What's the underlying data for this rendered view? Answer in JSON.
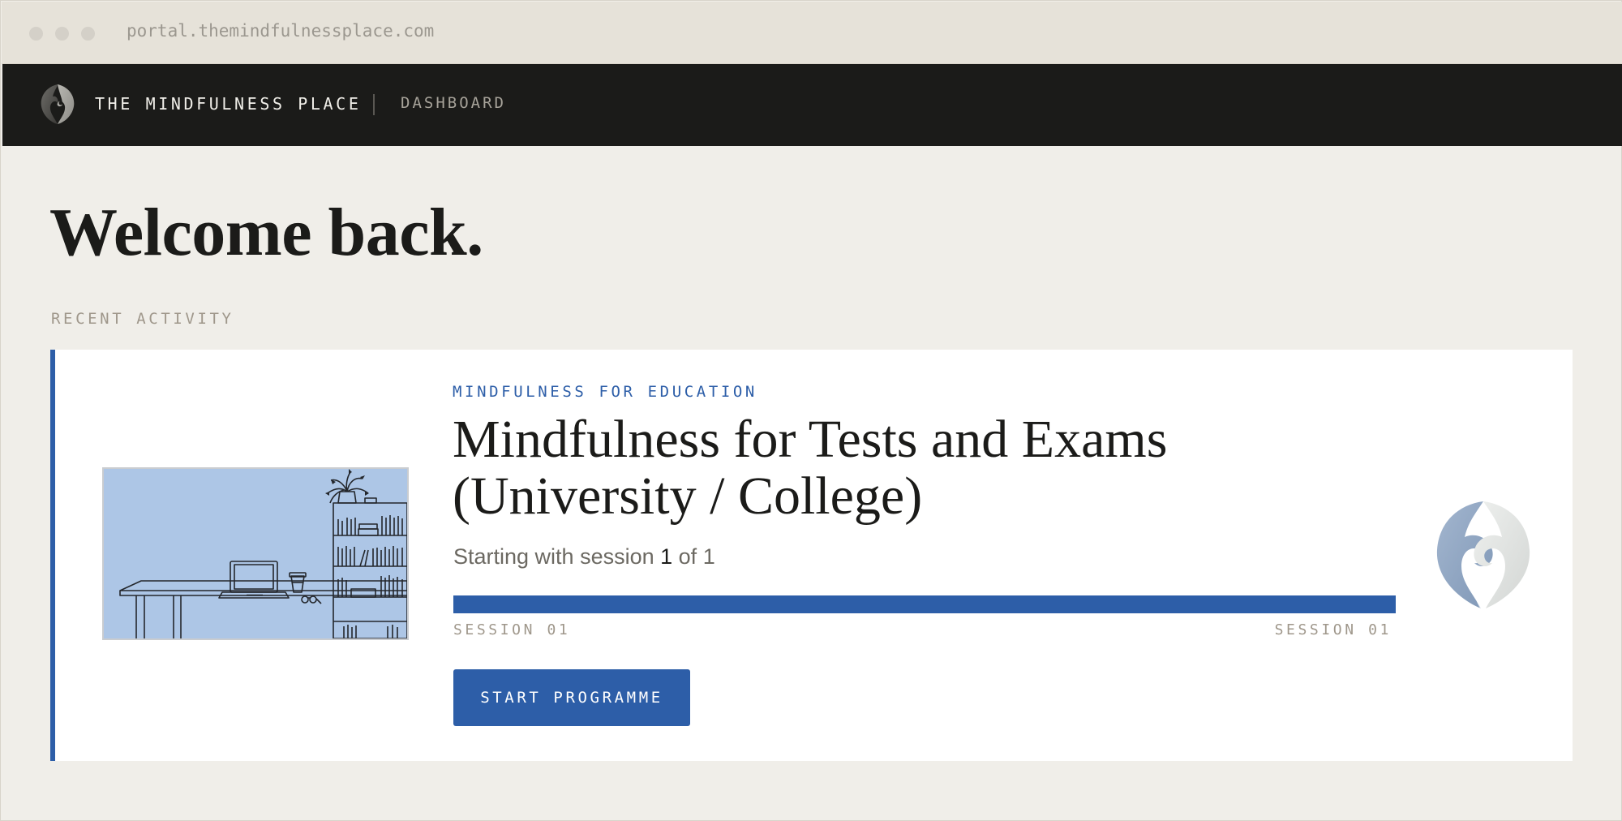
{
  "browser": {
    "url": "portal.themindfulnessplace.com"
  },
  "nav": {
    "brand": "THE MINDFULNESS PLACE",
    "link": "DASHBOARD",
    "logo_icon": "koru-logo-icon"
  },
  "main": {
    "heading": "Welcome back.",
    "section_label": "RECENT ACTIVITY",
    "course": {
      "category": "MINDFULNESS FOR EDUCATION",
      "title": "Mindfulness for Tests and Exams (University / College)",
      "progress_prefix": "Starting with session ",
      "current_session": "1",
      "progress_mid": " of ",
      "total_sessions": "1",
      "progress_fraction": 1.0,
      "session_start_label": "SESSION 01",
      "session_end_label": "SESSION 01",
      "button_label": "START PROGRAMME",
      "thumbnail_icon": "desk-illustration",
      "emblem_icon": "koru-emblem-icon"
    }
  },
  "colors": {
    "accent": "#2d5ea8",
    "nav_background": "#1b1b19",
    "page_background": "#f0eee9",
    "thumbnail_background": "#adc6e6"
  }
}
